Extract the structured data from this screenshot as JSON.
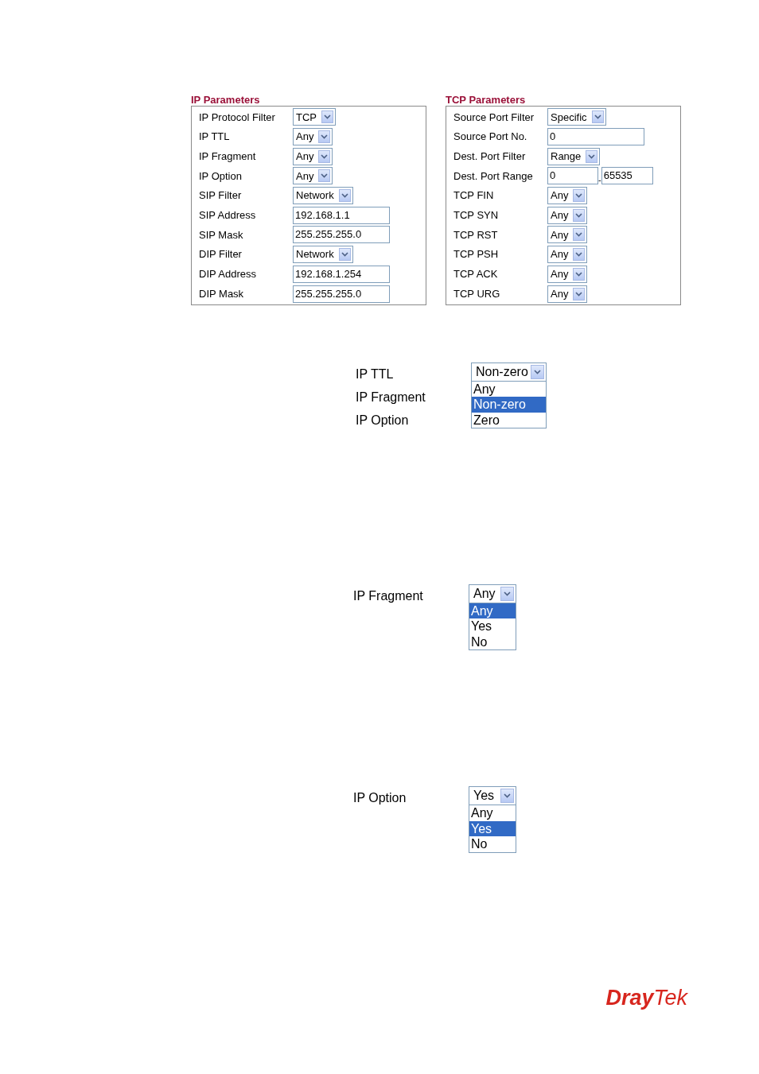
{
  "ip_parameters": {
    "title": "IP Parameters",
    "rows": [
      {
        "label": "IP Protocol Filter",
        "kind": "select",
        "value": "TCP"
      },
      {
        "label": "IP TTL",
        "kind": "select",
        "value": "Any"
      },
      {
        "label": "IP Fragment",
        "kind": "select",
        "value": "Any"
      },
      {
        "label": "IP Option",
        "kind": "select",
        "value": "Any"
      },
      {
        "label": "SIP Filter",
        "kind": "select",
        "value": "Network"
      },
      {
        "label": "SIP Address",
        "kind": "input",
        "value": "192.168.1.1"
      },
      {
        "label": "SIP Mask",
        "kind": "input",
        "value": "255.255.255.0"
      },
      {
        "label": "DIP Filter",
        "kind": "select",
        "value": "Network"
      },
      {
        "label": "DIP Address",
        "kind": "input",
        "value": "192.168.1.254"
      },
      {
        "label": "DIP Mask",
        "kind": "input",
        "value": "255.255.255.0"
      }
    ]
  },
  "tcp_parameters": {
    "title": "TCP Parameters",
    "rows": [
      {
        "label": "Source Port Filter",
        "kind": "select",
        "value": "Specific"
      },
      {
        "label": "Source Port No.",
        "kind": "input",
        "value": "0"
      },
      {
        "label": "Dest. Port Filter",
        "kind": "select",
        "value": "Range"
      },
      {
        "label": "Dest. Port Range",
        "kind": "range",
        "value": "0",
        "separator": "-",
        "value_to": "65535"
      },
      {
        "label": "TCP FIN",
        "kind": "select",
        "value": "Any"
      },
      {
        "label": "TCP SYN",
        "kind": "select",
        "value": "Any"
      },
      {
        "label": "TCP RST",
        "kind": "select",
        "value": "Any"
      },
      {
        "label": "TCP PSH",
        "kind": "select",
        "value": "Any"
      },
      {
        "label": "TCP ACK",
        "kind": "select",
        "value": "Any"
      },
      {
        "label": "TCP URG",
        "kind": "select",
        "value": "Any"
      }
    ]
  },
  "dropdown_examples": [
    {
      "labels": [
        "IP TTL",
        "IP Fragment",
        "IP Option"
      ],
      "value": "Non-zero",
      "options": [
        {
          "label": "Any",
          "selected": false
        },
        {
          "label": "Non-zero",
          "selected": true
        },
        {
          "label": "Zero",
          "selected": false
        }
      ]
    },
    {
      "labels": [
        "IP Fragment"
      ],
      "value": "Any",
      "options": [
        {
          "label": "Any",
          "selected": true
        },
        {
          "label": "Yes",
          "selected": false
        },
        {
          "label": "No",
          "selected": false
        }
      ]
    },
    {
      "labels": [
        "IP Option"
      ],
      "value": "Yes",
      "options": [
        {
          "label": "Any",
          "selected": false
        },
        {
          "label": "Yes",
          "selected": true
        },
        {
          "label": "No",
          "selected": false
        }
      ]
    }
  ],
  "logo": {
    "part_1": "Dray",
    "part_2": "Tek"
  }
}
